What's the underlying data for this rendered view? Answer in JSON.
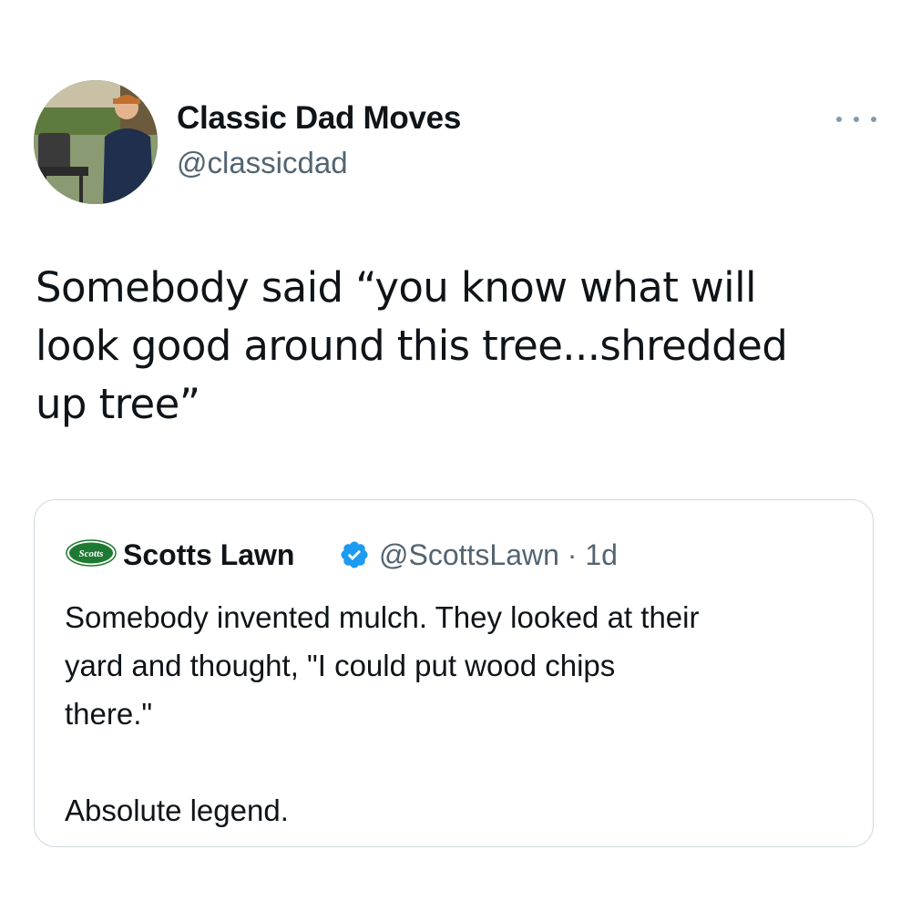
{
  "tweet": {
    "author": {
      "display_name": "Classic Dad Moves",
      "handle": "@classicdad",
      "avatar": "profile-photo-man-at-grill"
    },
    "more_icon": "ellipsis-icon",
    "text": "Somebody said “you know what will\nlook good around this tree...shredded\nup tree”"
  },
  "quoted_tweet": {
    "author": {
      "display_name": "Scotts Lawn",
      "verified": true,
      "logo_text": "Scotts",
      "handle": "@ScottsLawn",
      "time": "1d"
    },
    "handle_time": "@ScottsLawn · 1d",
    "text": "Somebody invented mulch. They looked at their\nyard and thought, \"I could put wood chips\nthere.\"\n\nAbsolute legend."
  },
  "colors": {
    "text": "#0f1419",
    "secondary": "#536471",
    "verified": "#1d9bf0",
    "border": "#cfd9de",
    "scotts_green": "#1e7a32"
  }
}
